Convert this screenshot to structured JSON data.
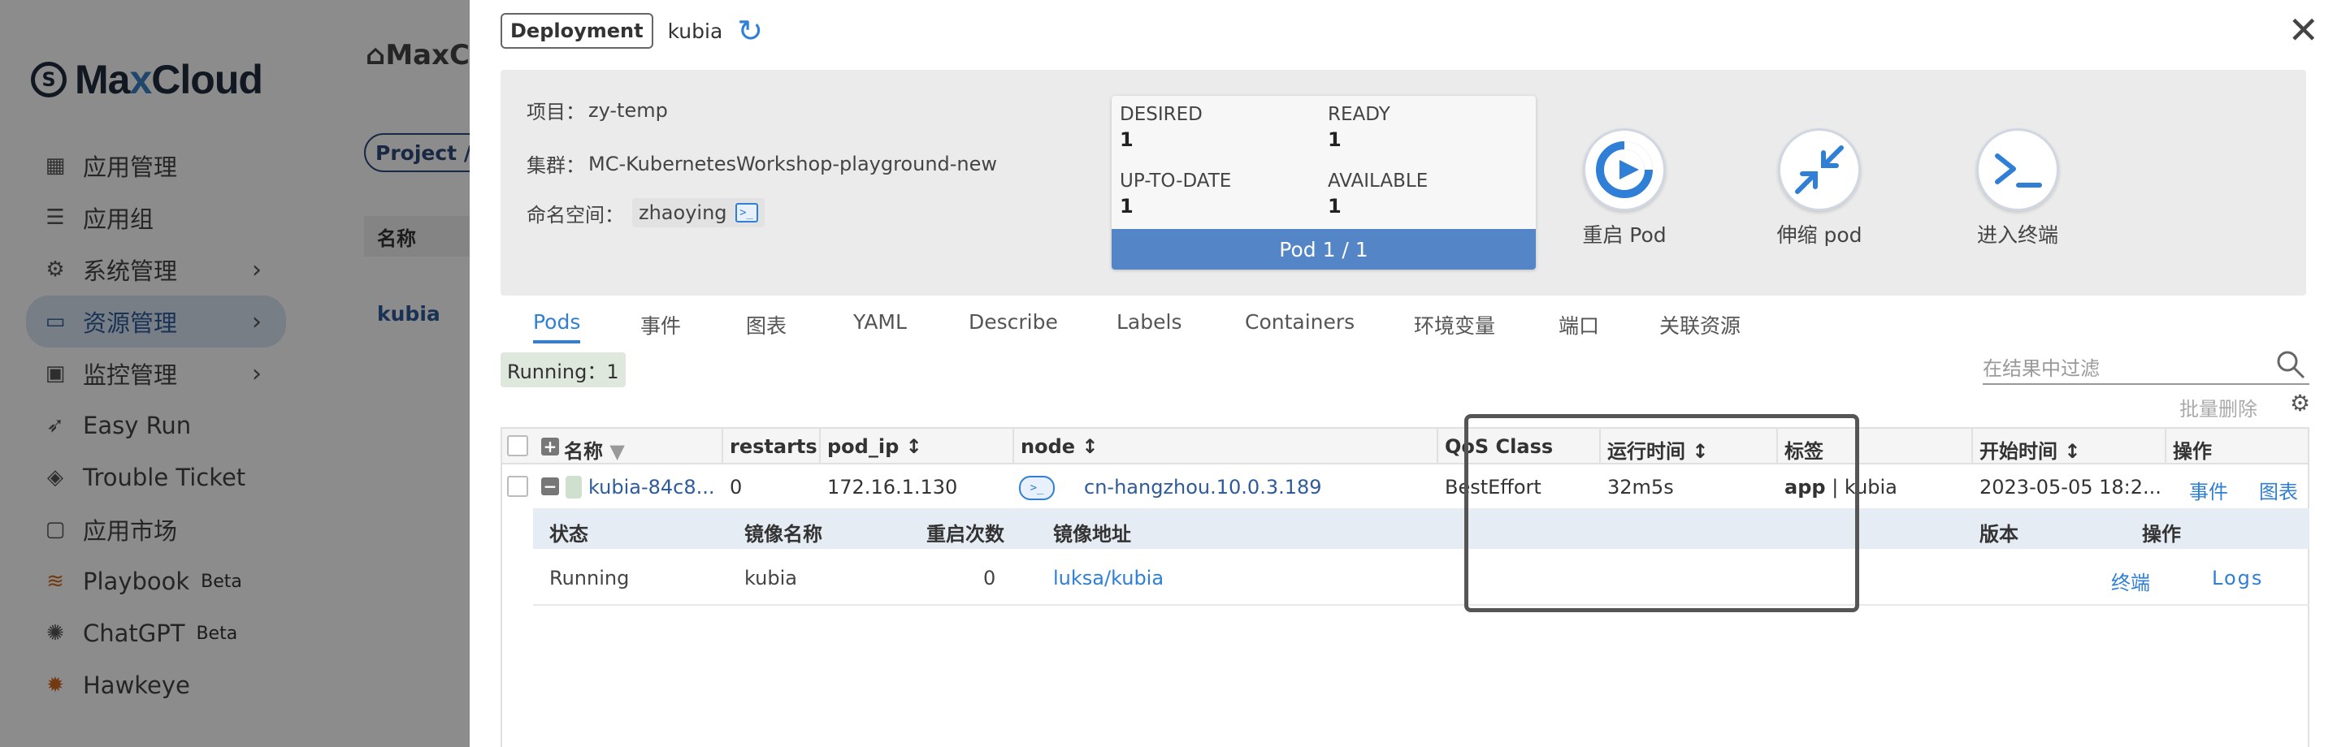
{
  "sidebar": {
    "logo_mark": "S",
    "logo_text_a": "Ma",
    "logo_text_x": "x",
    "logo_text_b": "Cloud",
    "items": [
      {
        "label": "应用管理",
        "icon": "grid-icon"
      },
      {
        "label": "应用组",
        "icon": "stack-icon"
      },
      {
        "label": "系统管理",
        "icon": "gear-icon",
        "chevron": true
      },
      {
        "label": "资源管理",
        "icon": "folder-icon",
        "chevron": true,
        "active": true
      },
      {
        "label": "监控管理",
        "icon": "monitor-icon",
        "chevron": true
      },
      {
        "label": "Easy Run",
        "icon": "rocket-icon"
      },
      {
        "label": "Trouble Ticket",
        "icon": "ticket-icon"
      },
      {
        "label": "应用市场",
        "icon": "bag-icon"
      },
      {
        "label": "Playbook",
        "icon": "playbook-icon",
        "badge": "Beta"
      },
      {
        "label": "ChatGPT",
        "icon": "chatgpt-icon",
        "badge": "Beta"
      },
      {
        "label": "Hawkeye",
        "icon": "hawkeye-icon"
      }
    ]
  },
  "background": {
    "breadcrumb": "MaxC",
    "project_chip": "Project /zy",
    "table_header": "名称",
    "table_row": "kubia"
  },
  "drawer": {
    "kind": "Deployment",
    "name": "kubia",
    "info": {
      "project_label": "项目：",
      "project_value": "zy-temp",
      "cluster_label": "集群：",
      "cluster_value": "MC-KubernetesWorkshop-playground-new",
      "namespace_label": "命名空间：",
      "namespace_value": "zhaoying"
    },
    "status": {
      "desired_label": "DESIRED",
      "desired_value": "1",
      "ready_label": "READY",
      "ready_value": "1",
      "uptodate_label": "UP-TO-DATE",
      "uptodate_value": "1",
      "available_label": "AVAILABLE",
      "available_value": "1",
      "pod_bar": "Pod 1 / 1"
    },
    "actions": {
      "restart": "重启 Pod",
      "scale": "伸缩 pod",
      "terminal": "进入终端"
    },
    "tabs": [
      "Pods",
      "事件",
      "图表",
      "YAML",
      "Describe",
      "Labels",
      "Containers",
      "环境变量",
      "端口",
      "关联资源"
    ],
    "running_chip": "Running：1",
    "filter_placeholder": "在结果中过滤",
    "bulk_delete": "批量删除",
    "table": {
      "headers": [
        "名称",
        "restarts",
        "pod_ip",
        "node",
        "QoS Class",
        "运行时间",
        "标签",
        "开始时间",
        "操作"
      ],
      "row": {
        "name": "kubia-84c8...",
        "restarts": "0",
        "pod_ip": "172.16.1.130",
        "node": "cn-hangzhou.10.0.3.189",
        "qos": "BestEffort",
        "runtime": "32m5s",
        "label_key": "app",
        "label_sep": " | ",
        "label_value": "kubia",
        "start_time": "2023-05-05 18:2...",
        "action_events": "事件",
        "action_charts": "图表"
      },
      "sub_headers": [
        "状态",
        "镜像名称",
        "重启次数",
        "镜像地址",
        "版本",
        "操作"
      ],
      "sub_row": {
        "status": "Running",
        "image_name": "kubia",
        "restarts": "0",
        "image_addr": "luksa/kubia",
        "version": "",
        "action_terminal": "终端",
        "action_logs": "Logs"
      }
    }
  },
  "colors": {
    "accent": "#2f7fd6",
    "pod_bar": "#5486c7",
    "sidebar_active_bg": "#dbe6f5"
  }
}
